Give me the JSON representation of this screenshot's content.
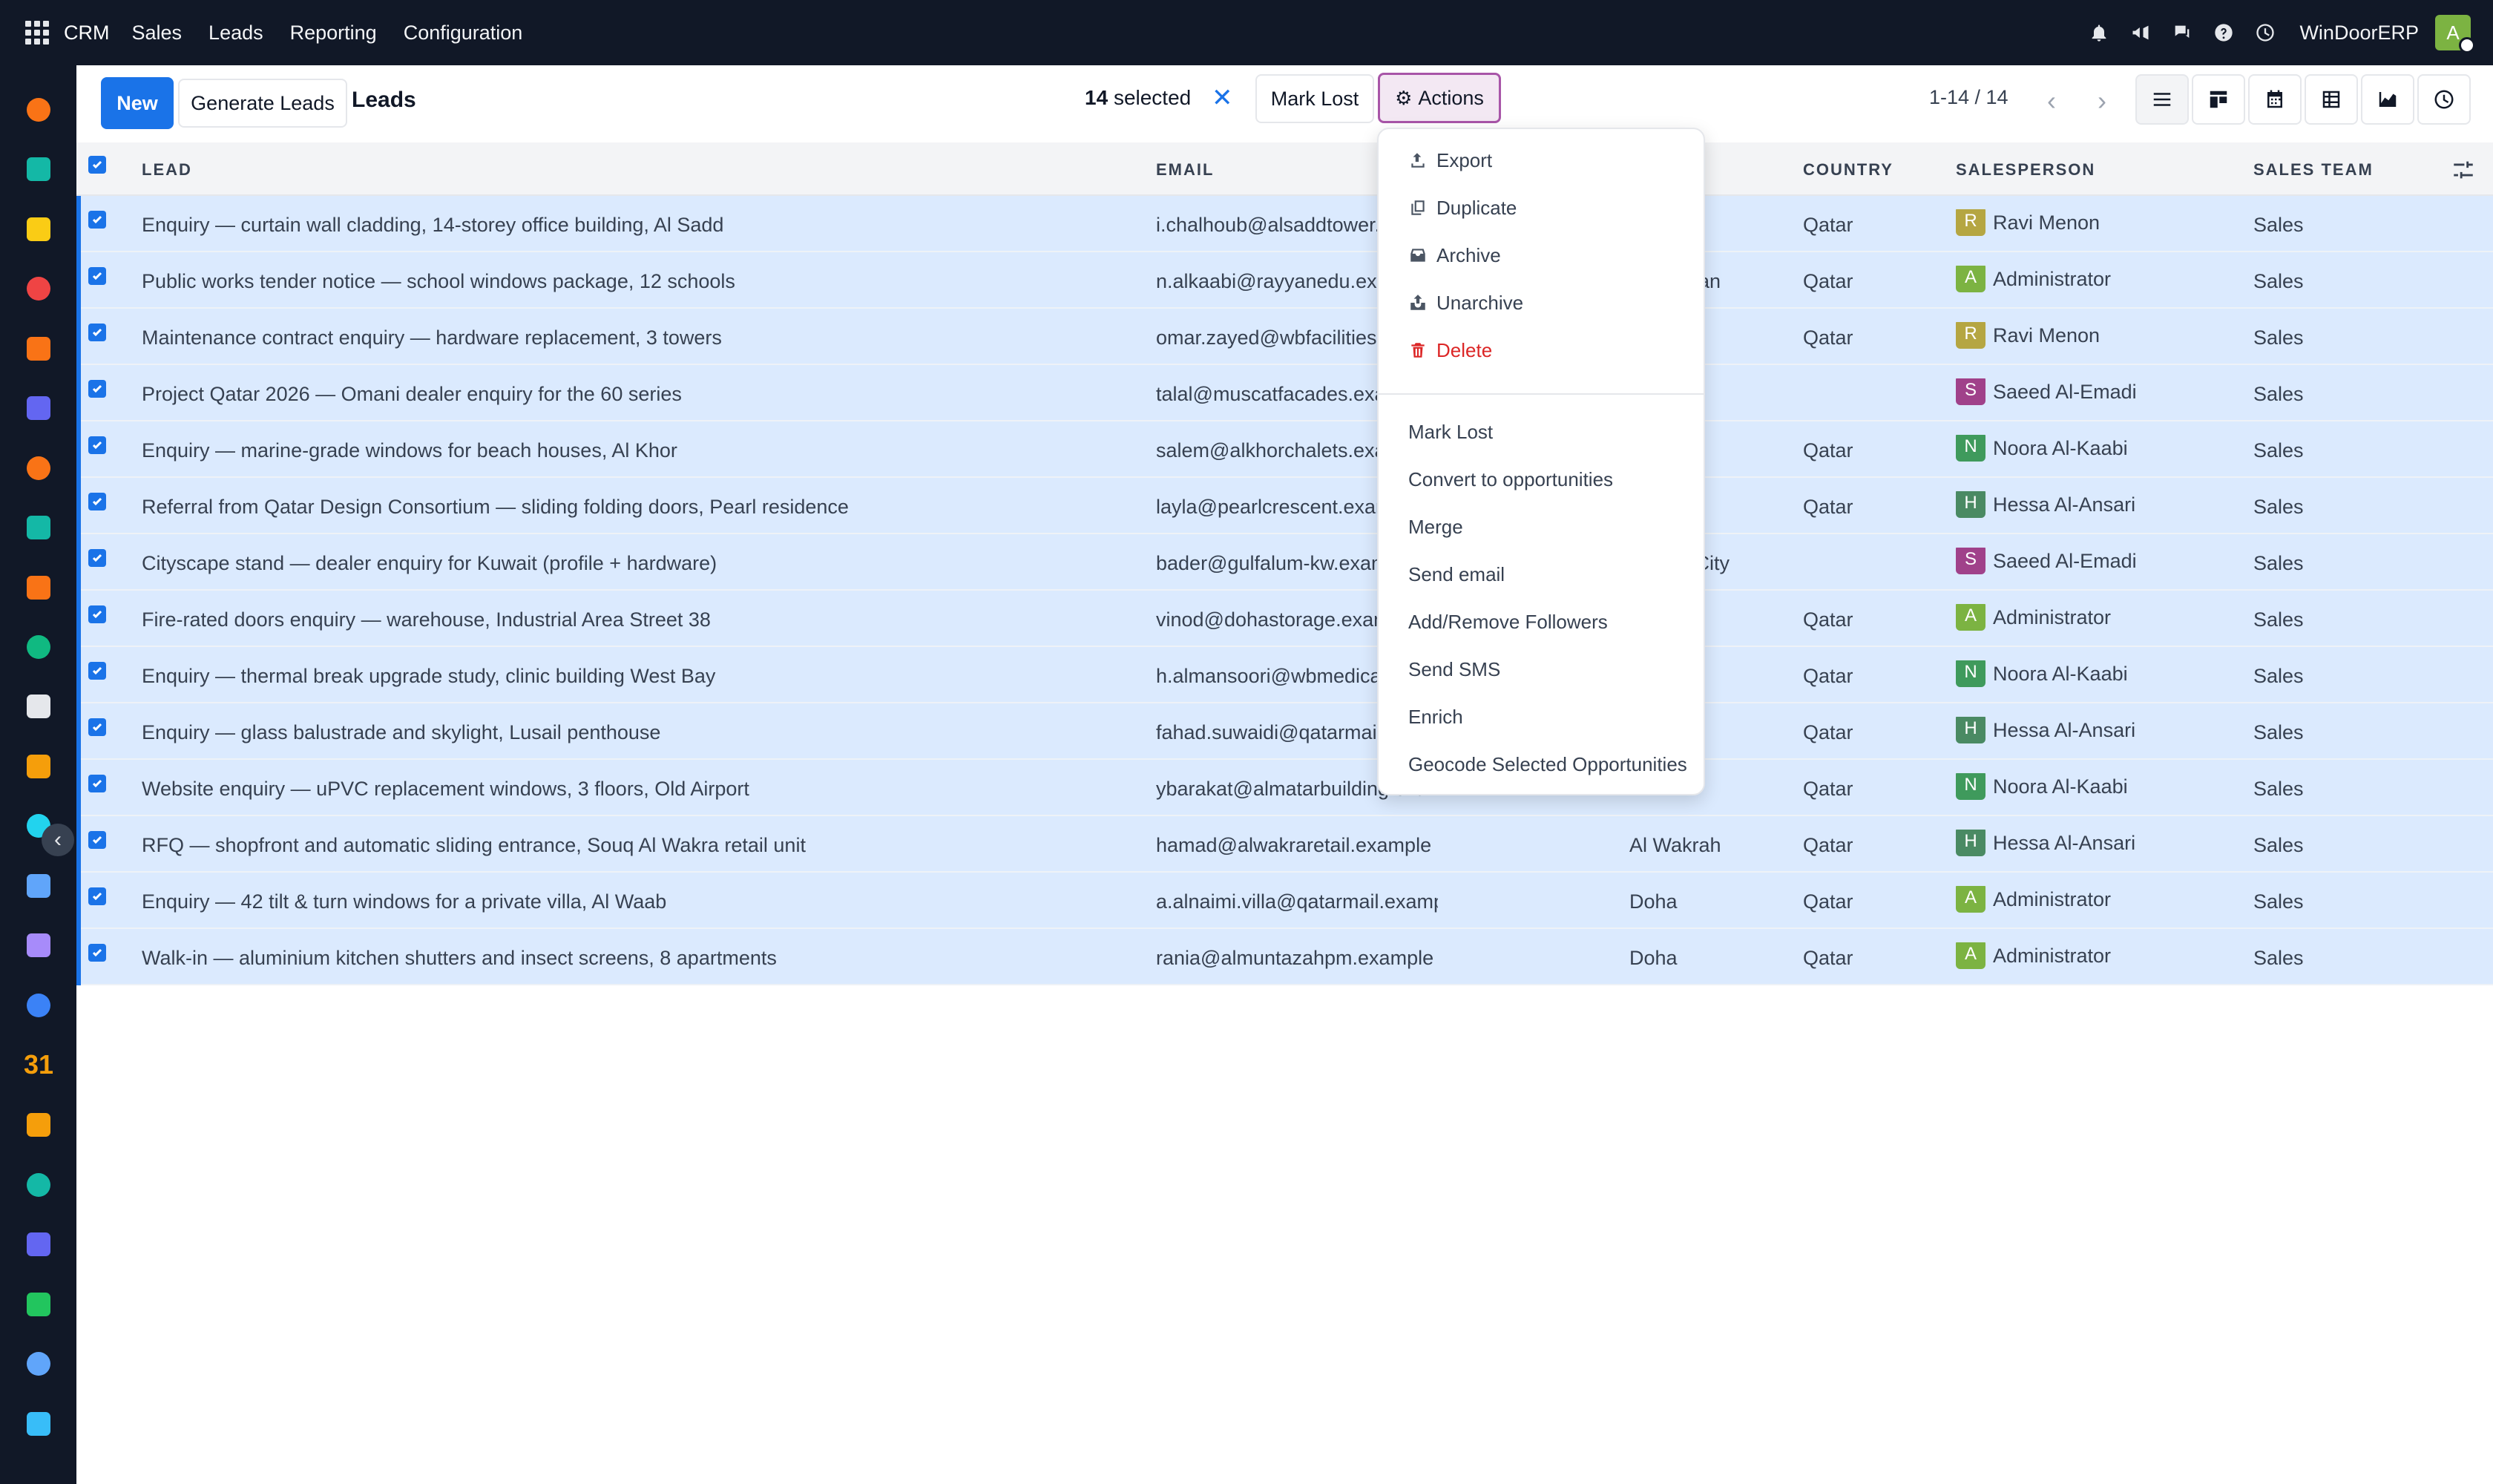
{
  "navbar": {
    "brand": "CRM",
    "menu": [
      "Sales",
      "Leads",
      "Reporting",
      "Configuration"
    ],
    "company": "WinDoorERP",
    "user_initial": "A"
  },
  "control": {
    "new_label": "New",
    "generate_label": "Generate Leads",
    "title": "Leads",
    "selected_count": "14",
    "selected_text": "selected",
    "clear_symbol": "✕",
    "mark_lost_label": "Mark Lost",
    "actions_label": "Actions",
    "pager": "1-14 / 14",
    "prev_symbol": "‹",
    "next_symbol": "›"
  },
  "columns": {
    "lead": "Lead",
    "email": "Email",
    "country": "Country",
    "salesperson": "Salesperson",
    "sales_team": "Sales Team"
  },
  "rows": [
    {
      "lead": "Enquiry — curtain wall cladding, 14-storey office building, Al Sadd",
      "email": "i.chalhoub@alsaddtower.example",
      "city": "",
      "country": "Qatar",
      "sp_initial": "R",
      "salesperson": "Ravi Menon",
      "team": "Sales"
    },
    {
      "lead": "Public works tender notice — school windows package, 12 schools",
      "email": "n.alkaabi@rayyanedu.example",
      "city": "Al Rayyan",
      "country": "Qatar",
      "sp_initial": "A",
      "salesperson": "Administrator",
      "team": "Sales"
    },
    {
      "lead": "Maintenance contract enquiry — hardware replacement, 3 towers",
      "email": "omar.zayed@wbfacilities.example",
      "city": "",
      "country": "Qatar",
      "sp_initial": "R",
      "salesperson": "Ravi Menon",
      "team": "Sales"
    },
    {
      "lead": "Project Qatar 2026 — Omani dealer enquiry for the 60 series",
      "email": "talal@muscatfacades.example",
      "city": "",
      "country": "",
      "sp_initial": "S",
      "salesperson": "Saeed Al-Emadi",
      "team": "Sales"
    },
    {
      "lead": "Enquiry — marine-grade windows for beach houses, Al Khor",
      "email": "salem@alkhorchalets.example",
      "city": "",
      "country": "Qatar",
      "sp_initial": "N",
      "salesperson": "Noora Al-Kaabi",
      "team": "Sales"
    },
    {
      "lead": "Referral from Qatar Design Consortium — sliding folding doors, Pearl residence",
      "email": "layla@pearlcrescent.example",
      "city": "",
      "country": "Qatar",
      "sp_initial": "H",
      "salesperson": "Hessa Al-Ansari",
      "team": "Sales"
    },
    {
      "lead": "Cityscape stand — dealer enquiry for Kuwait (profile + hardware)",
      "email": "bader@gulfalum-kw.example",
      "city": "Kuwait City",
      "country": "",
      "sp_initial": "S",
      "salesperson": "Saeed Al-Emadi",
      "team": "Sales"
    },
    {
      "lead": "Fire-rated doors enquiry — warehouse, Industrial Area Street 38",
      "email": "vinod@dohastorage.example",
      "city": "",
      "country": "Qatar",
      "sp_initial": "A",
      "salesperson": "Administrator",
      "team": "Sales"
    },
    {
      "lead": "Enquiry — thermal break upgrade study, clinic building West Bay",
      "email": "h.almansoori@wbmedical.example",
      "city": "",
      "country": "Qatar",
      "sp_initial": "N",
      "salesperson": "Noora Al-Kaabi",
      "team": "Sales"
    },
    {
      "lead": "Enquiry — glass balustrade and skylight, Lusail penthouse",
      "email": "fahad.suwaidi@qatarmail.example",
      "city": "",
      "country": "Qatar",
      "sp_initial": "H",
      "salesperson": "Hessa Al-Ansari",
      "team": "Sales"
    },
    {
      "lead": "Website enquiry — uPVC replacement windows, 3 floors, Old Airport",
      "email": "ybarakat@almatarbuilding.example",
      "city": "",
      "country": "Qatar",
      "sp_initial": "N",
      "salesperson": "Noora Al-Kaabi",
      "team": "Sales"
    },
    {
      "lead": "RFQ — shopfront and automatic sliding entrance, Souq Al Wakra retail unit",
      "email": "hamad@alwakraretail.example",
      "city": "Al Wakrah",
      "country": "Qatar",
      "sp_initial": "H",
      "salesperson": "Hessa Al-Ansari",
      "team": "Sales"
    },
    {
      "lead": "Enquiry — 42 tilt & turn windows for a private villa, Al Waab",
      "email": "a.alnaimi.villa@qatarmail.example",
      "city": "Doha",
      "country": "Qatar",
      "sp_initial": "A",
      "salesperson": "Administrator",
      "team": "Sales"
    },
    {
      "lead": "Walk-in — aluminium kitchen shutters and insect screens, 8 apartments",
      "email": "rania@almuntazahpm.example",
      "city": "Doha",
      "country": "Qatar",
      "sp_initial": "A",
      "salesperson": "Administrator",
      "team": "Sales"
    }
  ],
  "avatar_colors": {
    "R": "#b5a642",
    "A": "#7cb342",
    "S": "#a0418a",
    "N": "#3f9a5c",
    "H": "#4a8a63"
  },
  "dropdown": {
    "top_items": [
      {
        "icon": "export-icon",
        "label": "Export"
      },
      {
        "icon": "duplicate-icon",
        "label": "Duplicate"
      },
      {
        "icon": "archive-icon",
        "label": "Archive"
      },
      {
        "icon": "unarchive-icon",
        "label": "Unarchive"
      },
      {
        "icon": "trash-icon",
        "label": "Delete",
        "danger": true
      }
    ],
    "bottom_items": [
      "Mark Lost",
      "Convert to opportunities",
      "Merge",
      "Send email",
      "Add/Remove Followers",
      "Send SMS",
      "Enrich",
      "Geocode Selected Opportunities"
    ]
  },
  "sidebar_apps": [
    {
      "name": "app-icon-1",
      "color": "#f97316"
    },
    {
      "name": "app-icon-2",
      "color": "#14b8a6"
    },
    {
      "name": "app-icon-3",
      "color": "#facc15"
    },
    {
      "name": "app-icon-4",
      "color": "#ef4444"
    },
    {
      "name": "app-icon-5",
      "color": "#f97316"
    },
    {
      "name": "app-icon-6",
      "color": "#6366f1"
    },
    {
      "name": "app-icon-7",
      "color": "#f97316"
    },
    {
      "name": "app-icon-8",
      "color": "#14b8a6"
    },
    {
      "name": "app-icon-9",
      "color": "#f97316"
    },
    {
      "name": "app-icon-10",
      "color": "#10b981"
    },
    {
      "name": "app-icon-11",
      "color": "#e5e7eb"
    },
    {
      "name": "app-icon-12",
      "color": "#f59e0b"
    },
    {
      "name": "app-icon-13",
      "color": "#22d3ee"
    },
    {
      "name": "app-icon-14",
      "color": "#60a5fa"
    },
    {
      "name": "app-icon-15",
      "color": "#a78bfa"
    },
    {
      "name": "app-icon-16",
      "color": "#3b82f6"
    },
    {
      "name": "app-icon-17",
      "color": "#60a5fa"
    },
    {
      "name": "app-icon-18",
      "color": "#f59e0b"
    },
    {
      "name": "app-icon-19",
      "color": "#14b8a6"
    },
    {
      "name": "app-icon-20",
      "color": "#6366f1"
    },
    {
      "name": "app-icon-21",
      "color": "#22c55e"
    },
    {
      "name": "app-icon-22",
      "color": "#60a5fa"
    },
    {
      "name": "app-icon-23",
      "color": "#38bdf8"
    }
  ],
  "sidebar_calendar_label": "31"
}
